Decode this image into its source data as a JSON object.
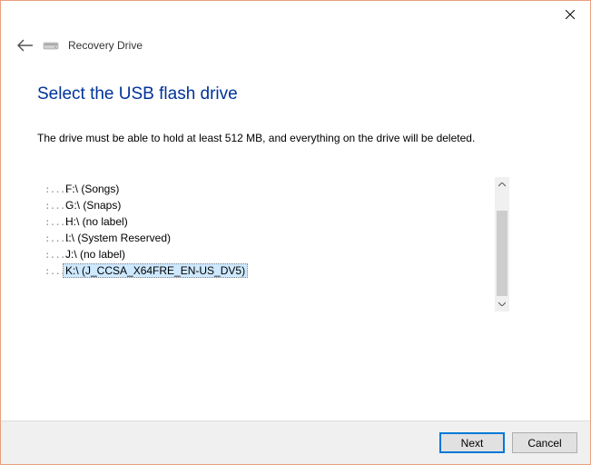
{
  "titlebar": {
    "close_label": "Close"
  },
  "header": {
    "back_label": "Back",
    "icon_name": "drive-icon",
    "title": "Recovery Drive"
  },
  "main": {
    "heading": "Select the USB flash drive",
    "instruction": "The drive must be able to hold at least 512 MB, and everything on the drive will be deleted."
  },
  "drives": [
    {
      "label": "F:\\ (Songs)",
      "selected": false
    },
    {
      "label": "G:\\ (Snaps)",
      "selected": false
    },
    {
      "label": "H:\\ (no label)",
      "selected": false
    },
    {
      "label": "I:\\ (System Reserved)",
      "selected": false
    },
    {
      "label": "J:\\ (no label)",
      "selected": false
    },
    {
      "label": "K:\\ (J_CCSA_X64FRE_EN-US_DV5)",
      "selected": true
    }
  ],
  "footer": {
    "next_label": "Next",
    "cancel_label": "Cancel"
  }
}
